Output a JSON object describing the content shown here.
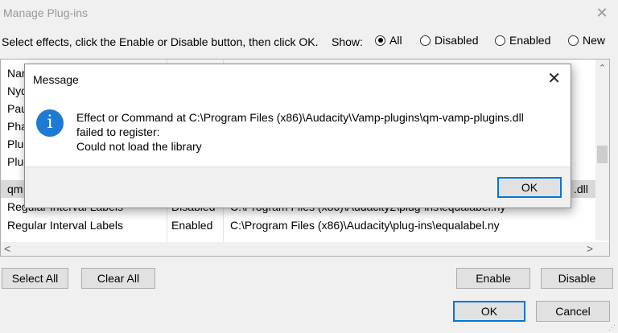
{
  "window": {
    "title": "Manage Plug-ins",
    "close_glyph": "✕"
  },
  "instruction": "Select effects, click the Enable or Disable button, then click OK.",
  "show": {
    "label": "Show:",
    "options": [
      {
        "label": "All",
        "selected": true
      },
      {
        "label": "Disabled",
        "selected": false
      },
      {
        "label": "Enabled",
        "selected": false
      },
      {
        "label": "New",
        "selected": false
      }
    ]
  },
  "list": {
    "rows": [
      {
        "c1": "Nar",
        "c2": "",
        "c3": ""
      },
      {
        "c1": "Nyq",
        "c2": "",
        "c3": ""
      },
      {
        "c1": "Pau",
        "c2": "",
        "c3": ""
      },
      {
        "c1": "Pha",
        "c2": "",
        "c3": ""
      },
      {
        "c1": "Plug",
        "c2": "",
        "c3": ""
      },
      {
        "c1": "Plug",
        "c2": "",
        "c3": ""
      },
      {
        "c1": "qm",
        "c2": "",
        "c3": ".dll"
      },
      {
        "c1": "Regular Interval Labels",
        "c2": "Disabled",
        "c3": "C:\\Program Files (x86)\\Audacity2\\plug-ins\\equalabel.ny"
      },
      {
        "c1": "Regular Interval Labels",
        "c2": "Enabled",
        "c3": "C:\\Program Files (x86)\\Audacity\\plug-ins\\equalabel.ny"
      }
    ],
    "selected_row": 6,
    "scroll_up": "⌃",
    "scroll_left": "<",
    "scroll_right": ">"
  },
  "buttons": {
    "select_all": "Select All",
    "clear_all": "Clear All",
    "enable": "Enable",
    "disable": "Disable",
    "ok": "OK",
    "cancel": "Cancel"
  },
  "message": {
    "title": "Message",
    "close_glyph": "✕",
    "icon_glyph": "i",
    "line1": "Effect or Command at C:\\Program Files (x86)\\Audacity\\Vamp-plugins\\qm-vamp-plugins.dll",
    "line2": "failed to register:",
    "line3": "Could not load the library",
    "ok": "OK"
  },
  "colors": {
    "accent": "#0078d7",
    "info_icon": "#1f7ad3"
  }
}
